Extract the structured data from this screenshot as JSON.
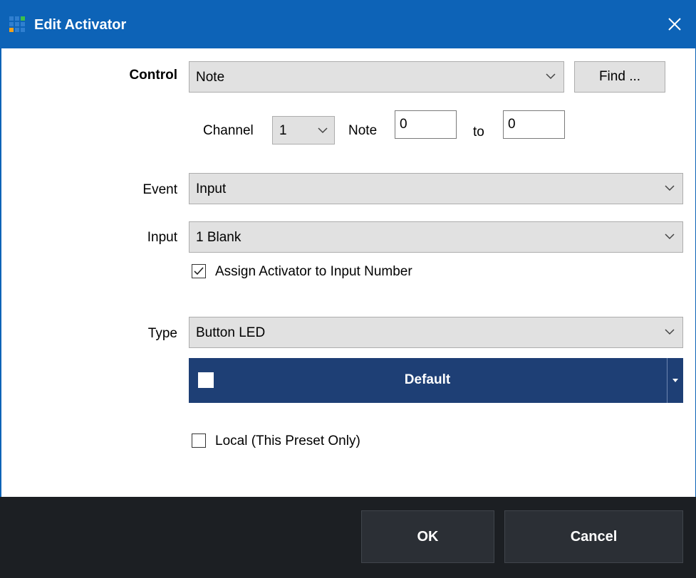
{
  "window": {
    "title": "Edit Activator",
    "close_icon": "close-icon",
    "titlebar_color": "#0d63b7"
  },
  "control": {
    "label": "Control",
    "value": "Note",
    "find_label": "Find ..."
  },
  "channel": {
    "label": "Channel",
    "value": "1"
  },
  "note": {
    "label": "Note",
    "from": "0",
    "to_label": "to",
    "to": "0"
  },
  "event": {
    "label": "Event",
    "value": "Input"
  },
  "input": {
    "label": "Input",
    "value": "1 Blank",
    "assign_label": "Assign Activator to Input Number",
    "assign_checked": true
  },
  "type": {
    "label": "Type",
    "value": "Button LED"
  },
  "color_button": {
    "label": "Default",
    "background": "#1e3f75",
    "swatch_color": "#ffffff"
  },
  "local": {
    "label": "Local (This Preset Only)",
    "checked": false
  },
  "footer": {
    "ok_label": "OK",
    "cancel_label": "Cancel",
    "background": "#1c1f23"
  }
}
